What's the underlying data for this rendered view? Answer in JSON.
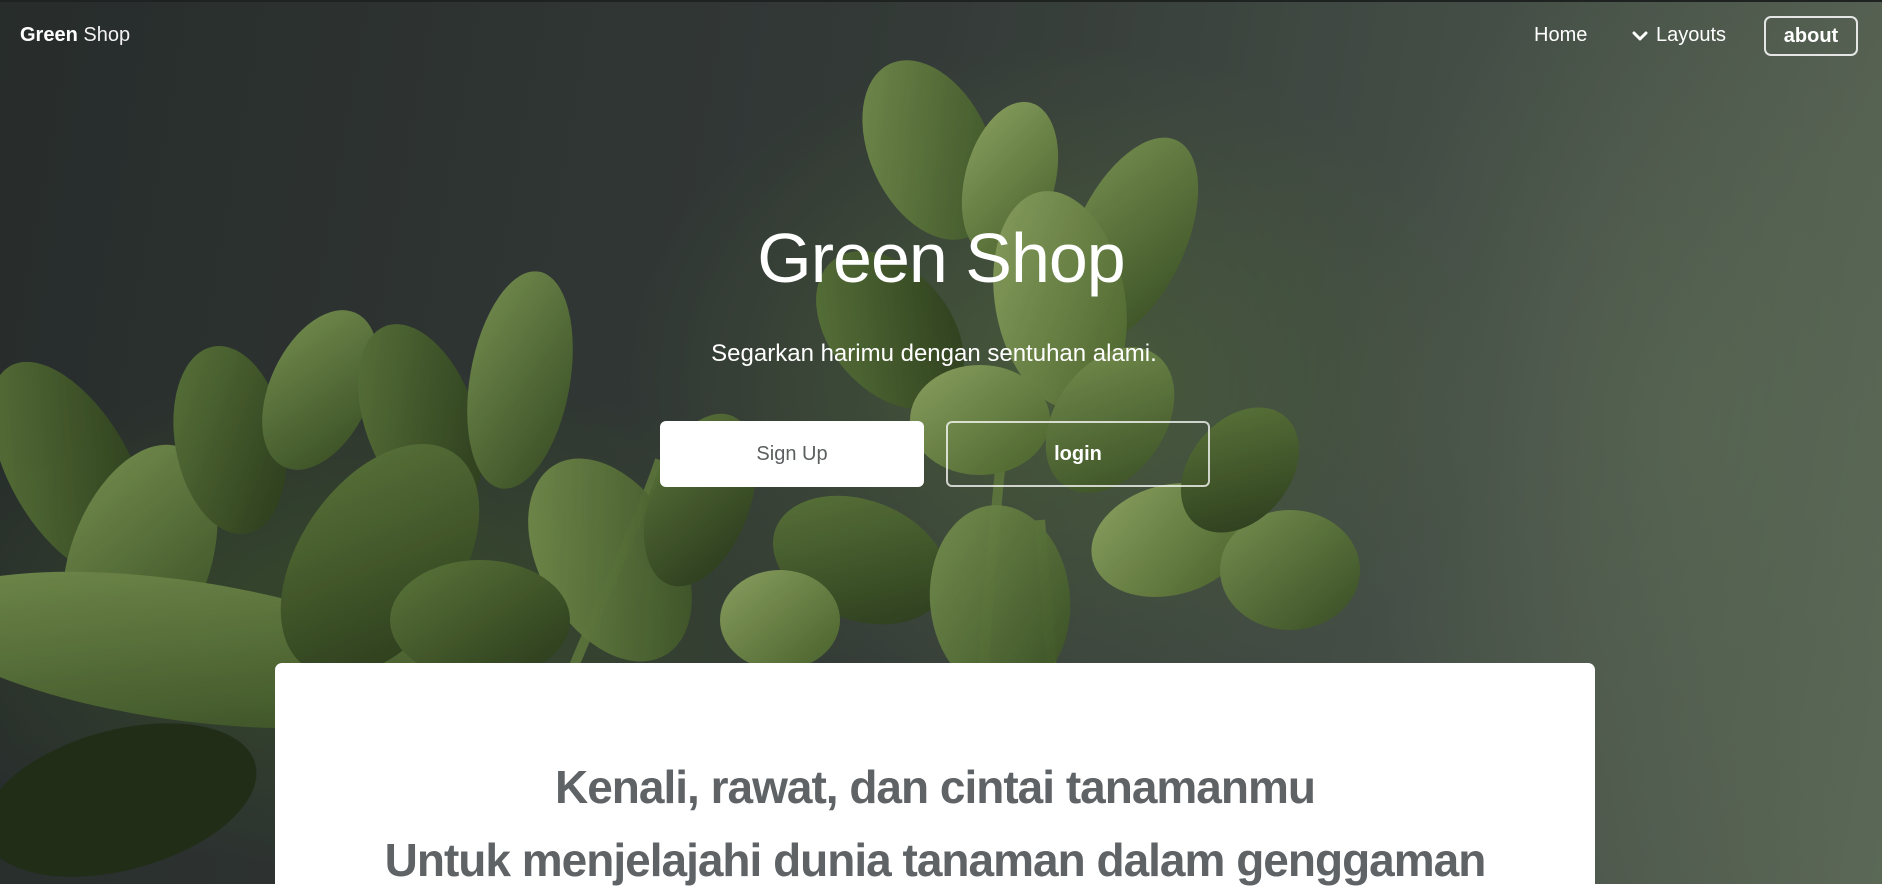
{
  "navbar": {
    "brand_strong": "Green",
    "brand_light": "Shop",
    "home": "Home",
    "layouts": "Layouts",
    "about": "about"
  },
  "hero": {
    "title": "Green Shop",
    "subtitle": "Segarkan harimu dengan sentuhan alami.",
    "signup": "Sign Up",
    "login": "login"
  },
  "card": {
    "line1": "Kenali, rawat, dan cintai tanamanmu",
    "line2": "Untuk menjelajahi dunia tanaman dalam genggaman"
  },
  "icons": {
    "layouts_dropdown": "chevron-down-icon"
  },
  "colors": {
    "hero_bg_dark": "#2b3230",
    "leaf_green": "#5f7a3c",
    "button_text": "#5b5f5f",
    "card_text": "#5f6366"
  }
}
